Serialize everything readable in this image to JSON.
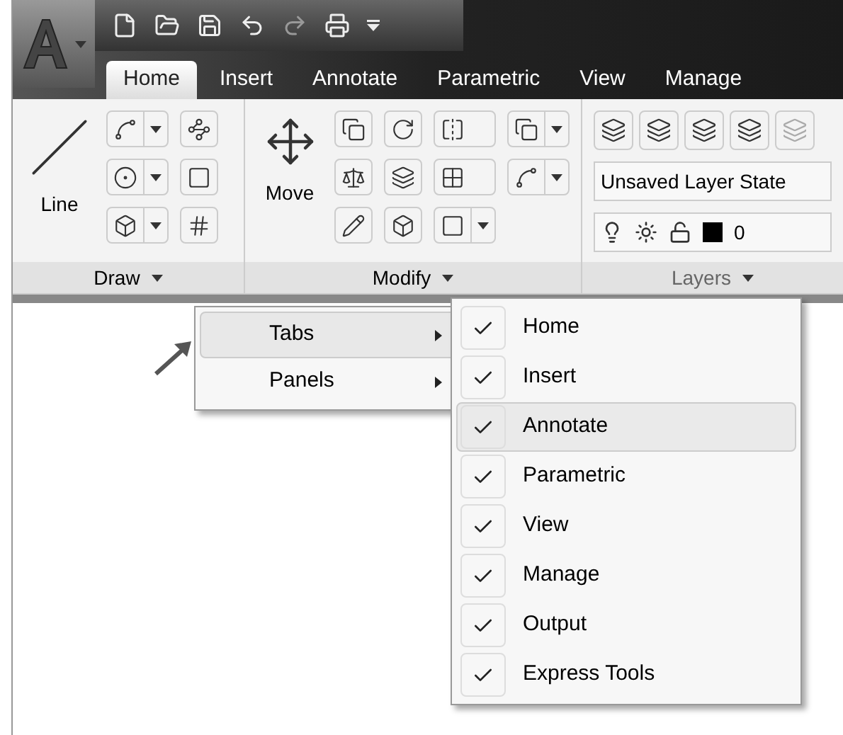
{
  "tabs": [
    {
      "label": "Home",
      "selected": true
    },
    {
      "label": "Insert",
      "selected": false
    },
    {
      "label": "Annotate",
      "selected": false
    },
    {
      "label": "Parametric",
      "selected": false
    },
    {
      "label": "View",
      "selected": false
    },
    {
      "label": "Manage",
      "selected": false
    }
  ],
  "panels": {
    "draw": {
      "big_button": "Line",
      "title": "Draw"
    },
    "modify": {
      "big_button": "Move",
      "title": "Modify"
    },
    "layers": {
      "layer_state": "Unsaved Layer State",
      "current_layer": "0",
      "title": "Layers"
    }
  },
  "context_menu": {
    "items": [
      {
        "label": "Tabs",
        "selected": true
      },
      {
        "label": "Panels",
        "selected": false
      }
    ],
    "submenu": [
      {
        "label": "Home",
        "checked": true,
        "selected": false
      },
      {
        "label": "Insert",
        "checked": true,
        "selected": false
      },
      {
        "label": "Annotate",
        "checked": true,
        "selected": true
      },
      {
        "label": "Parametric",
        "checked": true,
        "selected": false
      },
      {
        "label": "View",
        "checked": true,
        "selected": false
      },
      {
        "label": "Manage",
        "checked": true,
        "selected": false
      },
      {
        "label": "Output",
        "checked": true,
        "selected": false
      },
      {
        "label": "Express Tools",
        "checked": true,
        "selected": false
      }
    ]
  }
}
